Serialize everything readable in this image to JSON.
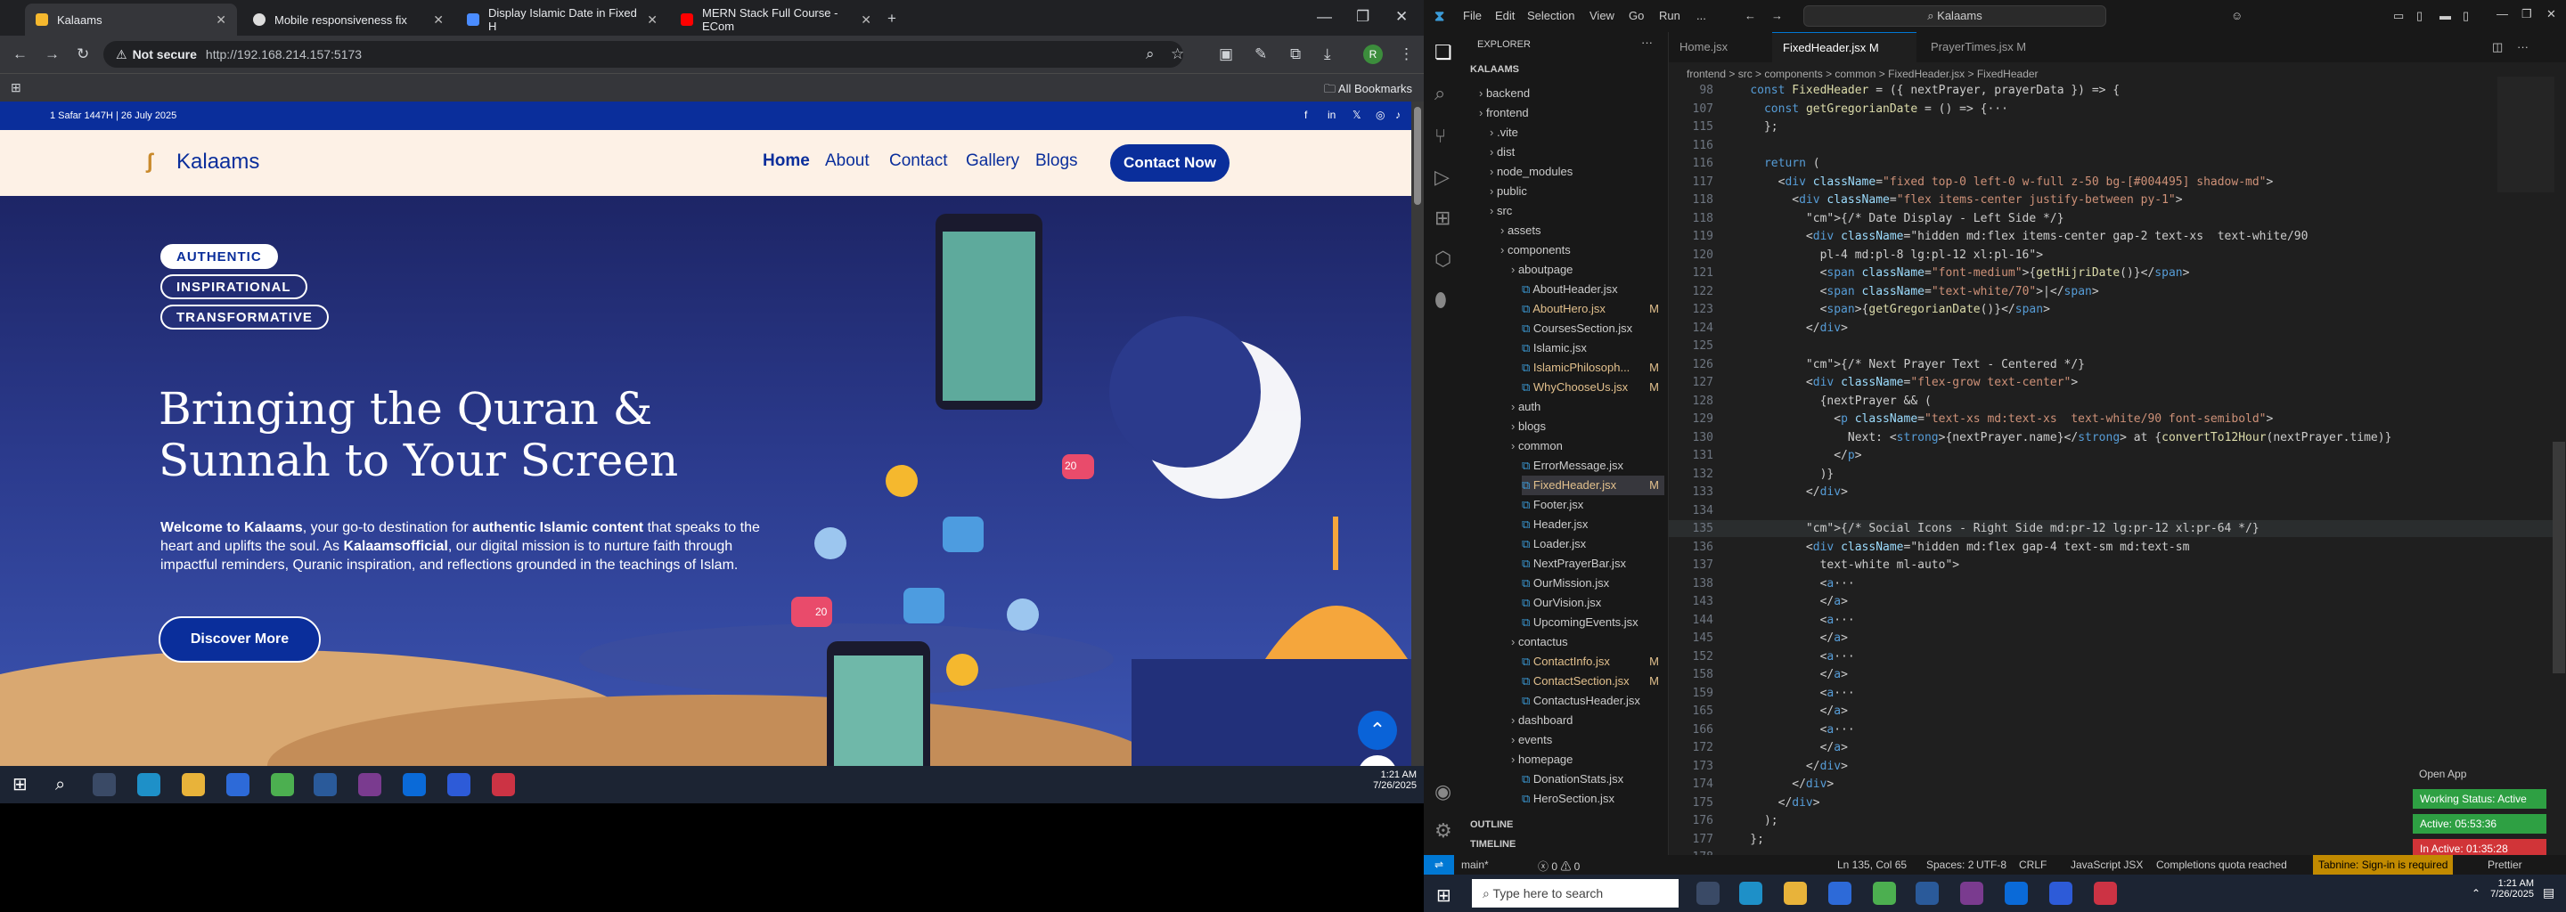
{
  "browser": {
    "tabs": [
      "Kalaams",
      "Mobile responsiveness fix",
      "Display Islamic Date in Fixed H",
      "MERN Stack Full Course - ECom"
    ],
    "not_secure": "Not secure",
    "url": "http://192.168.214.157:5173",
    "bookmarks": "All Bookmarks",
    "avatar_letter": "R"
  },
  "site": {
    "dates": "1 Safar 1447H | 26 July 2025",
    "brand": "Kalaams",
    "nav": [
      "Home",
      "About",
      "Contact",
      "Gallery",
      "Blogs"
    ],
    "cta": "Contact Now",
    "tags": [
      "AUTHENTIC",
      "INSPIRATIONAL",
      "TRANSFORMATIVE"
    ],
    "headline_l1": "Bringing the Quran &",
    "headline_l2": "Sunnah to Your Screen",
    "para_p1": "Welcome to Kalaams",
    "para_p2": ", your go-to destination for ",
    "para_p3": "authentic Islamic content",
    "para_p4": " that speaks to the heart and uplifts the soul. As ",
    "para_p5": "Kalaamsofficial",
    "para_p6": ", our digital mission is to nurture faith through impactful reminders, Quranic inspiration, and reflections grounded in the teachings of Islam.",
    "discover": "Discover More",
    "social_like_count": "20",
    "social_heart_count": "20"
  },
  "taskbar": {
    "time": "1:21 AM",
    "date": "7/26/2025"
  },
  "vscode": {
    "menu": [
      "File",
      "Edit",
      "Selection",
      "View",
      "Go",
      "Run",
      "..."
    ],
    "search": "Kalaams",
    "explorer_title": "EXPLORER",
    "project": "KALAAMS",
    "tree": [
      {
        "n": "backend",
        "d": 1,
        "f": 1
      },
      {
        "n": "frontend",
        "d": 1,
        "f": 1
      },
      {
        "n": ".vite",
        "d": 2,
        "f": 1
      },
      {
        "n": "dist",
        "d": 2,
        "f": 1
      },
      {
        "n": "node_modules",
        "d": 2,
        "f": 1
      },
      {
        "n": "public",
        "d": 2,
        "f": 1
      },
      {
        "n": "src",
        "d": 2,
        "f": 1
      },
      {
        "n": "assets",
        "d": 3,
        "f": 1
      },
      {
        "n": "components",
        "d": 3,
        "f": 1
      },
      {
        "n": "aboutpage",
        "d": 4,
        "f": 1
      },
      {
        "n": "AboutHeader.jsx",
        "d": 5
      },
      {
        "n": "AboutHero.jsx",
        "d": 5,
        "m": "M"
      },
      {
        "n": "CoursesSection.jsx",
        "d": 5
      },
      {
        "n": "Islamic.jsx",
        "d": 5
      },
      {
        "n": "IslamicPhilosoph...",
        "d": 5,
        "m": "M"
      },
      {
        "n": "WhyChooseUs.jsx",
        "d": 5,
        "m": "M"
      },
      {
        "n": "auth",
        "d": 4,
        "f": 1
      },
      {
        "n": "blogs",
        "d": 4,
        "f": 1
      },
      {
        "n": "common",
        "d": 4,
        "f": 1
      },
      {
        "n": "ErrorMessage.jsx",
        "d": 5
      },
      {
        "n": "FixedHeader.jsx",
        "d": 5,
        "m": "M"
      },
      {
        "n": "Footer.jsx",
        "d": 5
      },
      {
        "n": "Header.jsx",
        "d": 5
      },
      {
        "n": "Loader.jsx",
        "d": 5
      },
      {
        "n": "NextPrayerBar.jsx",
        "d": 5
      },
      {
        "n": "OurMission.jsx",
        "d": 5
      },
      {
        "n": "OurVision.jsx",
        "d": 5
      },
      {
        "n": "UpcomingEvents.jsx",
        "d": 5
      },
      {
        "n": "contactus",
        "d": 4,
        "f": 1
      },
      {
        "n": "ContactInfo.jsx",
        "d": 5,
        "m": "M"
      },
      {
        "n": "ContactSection.jsx",
        "d": 5,
        "m": "M"
      },
      {
        "n": "ContactusHeader.jsx",
        "d": 5
      },
      {
        "n": "dashboard",
        "d": 4,
        "f": 1
      },
      {
        "n": "events",
        "d": 4,
        "f": 1
      },
      {
        "n": "homepage",
        "d": 4,
        "f": 1
      },
      {
        "n": "DonationStats.jsx",
        "d": 5
      },
      {
        "n": "HeroSection.jsx",
        "d": 5
      }
    ],
    "outline": "OUTLINE",
    "timeline": "TIMELINE",
    "tabs": [
      "Home.jsx",
      "FixedHeader.jsx M",
      "PrayerTimes.jsx M"
    ],
    "breadcrumb": "frontend > src > components > common > FixedHeader.jsx > FixedHeader",
    "lines": [
      [
        "98",
        "const FixedHeader = ({ nextPrayer, prayerData }) => {"
      ],
      [
        "107",
        "  const getGregorianDate = () => {···"
      ],
      [
        "115",
        "  };"
      ],
      [
        "116",
        ""
      ],
      [
        "116",
        "  return ("
      ],
      [
        "117",
        "    <div className=\"fixed top-0 left-0 w-full z-50 bg-[#004495] shadow-md\">"
      ],
      [
        "118",
        "      <div className=\"flex items-center justify-between py-1\">"
      ],
      [
        "118",
        "        {/* Date Display - Left Side */}"
      ],
      [
        "119",
        "        <div className=\"hidden md:flex items-center gap-2 text-xs  text-white/90"
      ],
      [
        "120",
        "          pl-4 md:pl-8 lg:pl-12 xl:pl-16\">"
      ],
      [
        "121",
        "          <span className=\"font-medium\">{getHijriDate()}</span>"
      ],
      [
        "122",
        "          <span className=\"text-white/70\">|</span>"
      ],
      [
        "123",
        "          <span>{getGregorianDate()}</span>"
      ],
      [
        "124",
        "        </div>"
      ],
      [
        "125",
        ""
      ],
      [
        "126",
        "        {/* Next Prayer Text - Centered */}"
      ],
      [
        "127",
        "        <div className=\"flex-grow text-center\">"
      ],
      [
        "128",
        "          {nextPrayer && ("
      ],
      [
        "129",
        "            <p className=\"text-xs md:text-xs  text-white/90 font-semibold\">"
      ],
      [
        "130",
        "              Next: <strong>{nextPrayer.name}</strong> at {convertTo12Hour(nextPrayer.time)}"
      ],
      [
        "131",
        "            </p>"
      ],
      [
        "132",
        "          )}"
      ],
      [
        "133",
        "        </div>"
      ],
      [
        "134",
        ""
      ],
      [
        "135",
        "        {/* Social Icons - Right Side md:pr-12 lg:pr-12 xl:pr-64 */}"
      ],
      [
        "136",
        "        <div className=\"hidden md:flex gap-4 text-sm md:text-sm"
      ],
      [
        "137",
        "          text-white ml-auto\">"
      ],
      [
        "138",
        "          <a···"
      ],
      [
        "143",
        "          </a>"
      ],
      [
        "144",
        "          <a···"
      ],
      [
        "145",
        "          </a>"
      ],
      [
        "152",
        "          <a···"
      ],
      [
        "158",
        "          </a>"
      ],
      [
        "159",
        "          <a···"
      ],
      [
        "165",
        "          </a>"
      ],
      [
        "166",
        "          <a···"
      ],
      [
        "172",
        "          </a>"
      ],
      [
        "173",
        "        </div>"
      ],
      [
        "174",
        "      </div>"
      ],
      [
        "175",
        "    </div>"
      ],
      [
        "176",
        "  );"
      ],
      [
        "177",
        "};"
      ],
      [
        "178",
        ""
      ],
      [
        "179",
        "export default FixedHeader;"
      ]
    ],
    "open_app": "Open App",
    "status_left": "main*",
    "status_errors": "0 ⚠ 0",
    "status_pos": "Ln 135, Col 65",
    "status_spaces": "Spaces: 2",
    "status_enc": "UTF-8",
    "status_eol": "CRLF",
    "status_lang": "JavaScript JSX",
    "status_quota": "Completions quota reached",
    "status_tabnine": "Tabnine: Sign-in is required",
    "status_prettier": "Prettier",
    "working_status": "Working Status: Active",
    "active_time": "Active: 05:53:36",
    "inactive_time": "In Active: 01:35:28",
    "taskbar_search": "Type here to search",
    "time": "1:21 AM",
    "date": "7/26/2025"
  },
  "colors": {
    "brand": "#0a2e9b",
    "accent": "#0078d4",
    "green": "#2ea043",
    "red": "#d13438",
    "gold": "#f5b82e"
  }
}
